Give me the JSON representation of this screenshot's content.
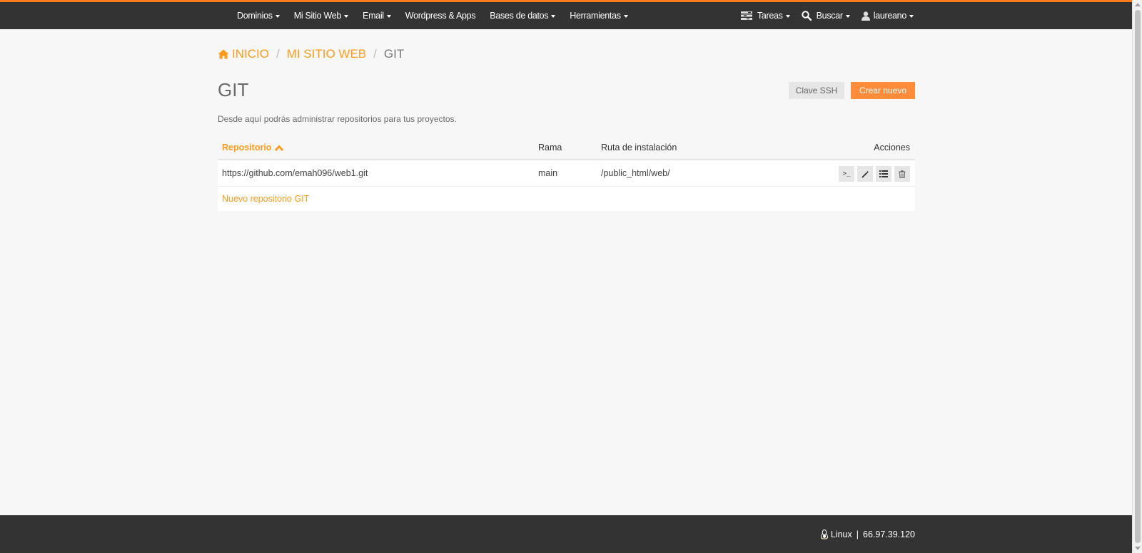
{
  "topnav": {
    "left_items": [
      {
        "label": "Dominios"
      },
      {
        "label": "Mi Sitio Web"
      },
      {
        "label": "Email"
      },
      {
        "label": "Wordpress & Apps"
      },
      {
        "label": "Bases de datos"
      },
      {
        "label": "Herramientas"
      }
    ],
    "tasks_label": "Tareas",
    "search_label": "Buscar",
    "user_label": "laureano"
  },
  "breadcrumb": {
    "home": "INICIO",
    "section": "MI SITIO WEB",
    "current": "GIT",
    "separator": "/"
  },
  "page": {
    "title": "GIT",
    "description": "Desde aquí podrás administrar repositorios para tus proyectos.",
    "ssh_button": "Clave SSH",
    "create_button": "Crear nuevo"
  },
  "table": {
    "columns": {
      "repo": "Repositorio",
      "branch": "Rama",
      "path": "Ruta de instalación",
      "actions": "Acciones"
    },
    "rows": [
      {
        "repo": "https://github.com/emah096/web1.git",
        "branch": "main",
        "path": "/public_html/web/"
      }
    ],
    "action_terminal_label": ">_",
    "new_repo_link": "Nuevo repositorio GIT"
  },
  "footer": {
    "os": "Linux",
    "separator": "|",
    "ip": "66.97.39.120"
  },
  "colors": {
    "accent": "#ff9a1a",
    "create_button": "#ff8c3a",
    "nav_bg": "#333333",
    "top_border": "#ff7a1a"
  },
  "icons": {
    "home": "home-icon",
    "sort": "chevron-up-icon",
    "tasks": "tasks-icon",
    "search": "search-icon",
    "user": "user-icon",
    "terminal": "terminal-icon",
    "edit": "magic-wand-icon",
    "list": "list-icon",
    "delete": "trash-icon",
    "os": "linux-icon"
  }
}
